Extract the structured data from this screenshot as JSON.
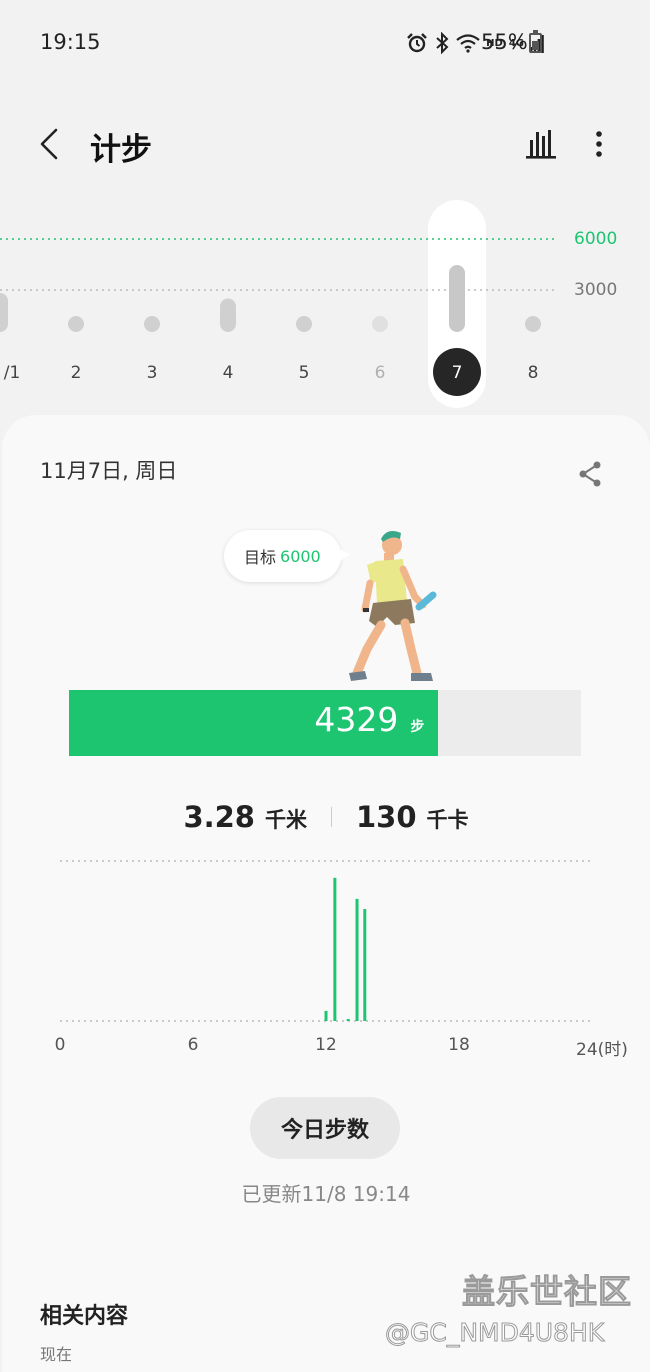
{
  "status_bar": {
    "time": "19:15",
    "network_label": "HD",
    "network_type": "4G",
    "battery_percent": "55%",
    "icons": [
      "alarm-icon",
      "bluetooth-icon",
      "wifi-icon",
      "signal-icon",
      "battery-icon"
    ]
  },
  "app_bar": {
    "title": "计步",
    "icons": [
      "back-arrow-icon",
      "bar-chart-icon",
      "more-vert-icon"
    ]
  },
  "week_chart": {
    "goal_label": "6000",
    "mid_label": "3000",
    "selected_day": "7",
    "days": [
      {
        "label": "/1",
        "level": 0.42,
        "dim": false
      },
      {
        "label": "2",
        "level": 0.0,
        "dim": false
      },
      {
        "label": "3",
        "level": 0.05,
        "dim": false
      },
      {
        "label": "4",
        "level": 0.36,
        "dim": false
      },
      {
        "label": "5",
        "level": 0.0,
        "dim": false
      },
      {
        "label": "6",
        "level": 0.0,
        "dim": true
      },
      {
        "label": "7",
        "level": 0.72,
        "dim": false
      },
      {
        "label": "8",
        "level": 0.0,
        "dim": false
      }
    ]
  },
  "day_card": {
    "date": "11月7日, 周日",
    "goal_prefix": "目标",
    "goal_value": "6000",
    "steps": "4329",
    "steps_unit": "步",
    "progress_fraction": 0.7215,
    "distance": "3.28",
    "distance_unit": "千米",
    "calories": "130",
    "calories_unit": "千卡"
  },
  "chart_data": {
    "type": "bar",
    "x_ticks": [
      "0",
      "6",
      "12",
      "18",
      "24(时)"
    ],
    "xlim": [
      0,
      24
    ],
    "bars": [
      {
        "hour": 12.0,
        "steps": 120
      },
      {
        "hour": 12.4,
        "steps": 1700
      },
      {
        "hour": 13.0,
        "steps": 20
      },
      {
        "hour": 13.4,
        "steps": 1450
      },
      {
        "hour": 13.75,
        "steps": 1330
      }
    ]
  },
  "today_button": "今日步数",
  "updated_text": "已更新11/8 19:14",
  "related": {
    "title": "相关内容",
    "subtitle": "现在"
  },
  "watermark": {
    "line1": "盖乐世社区",
    "line2": "@GC_NMD4U8HK"
  },
  "colors": {
    "accent": "#1ec571",
    "bar_inactive": "#d0d0d0",
    "selected_dark": "#262626"
  }
}
